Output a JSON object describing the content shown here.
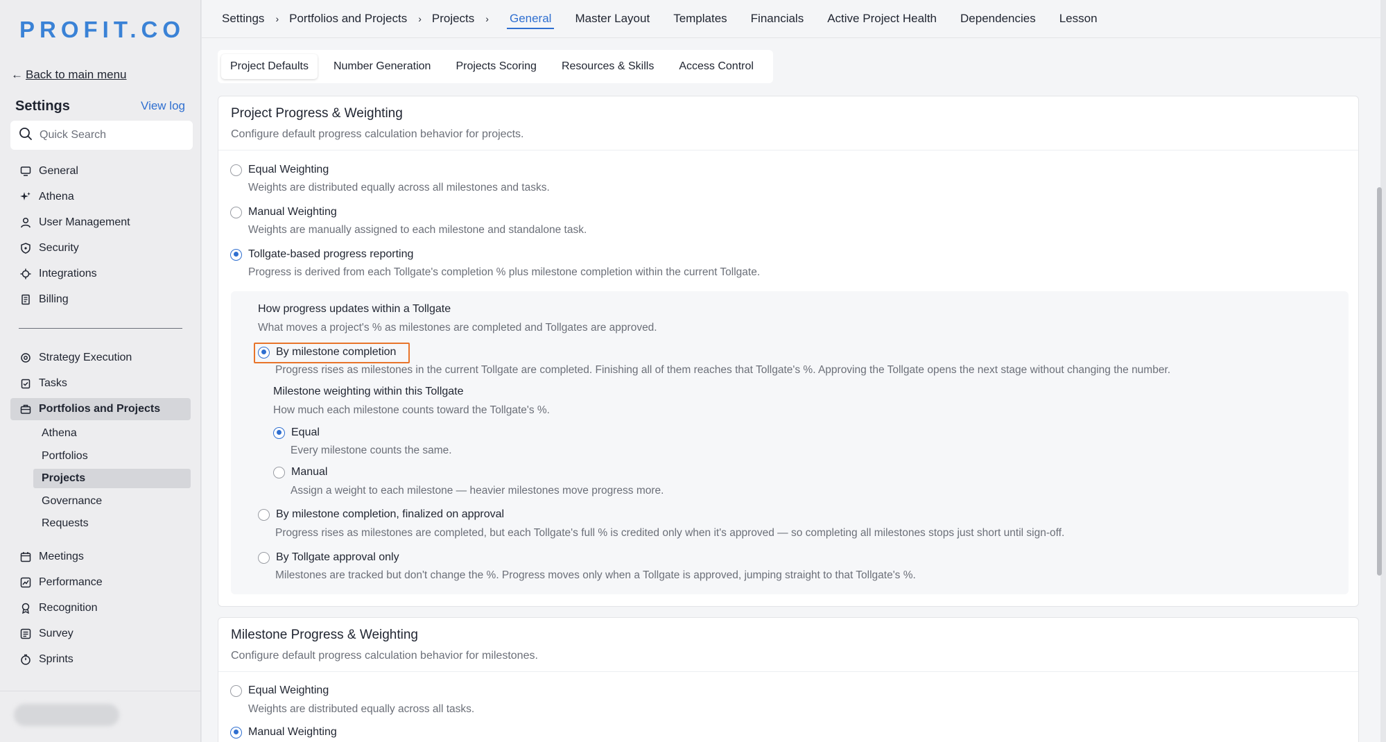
{
  "sidebar": {
    "logo": "PROFIT.CO",
    "back_link": "Back to main menu",
    "settings_title": "Settings",
    "view_log": "View log",
    "search_placeholder": "Quick Search",
    "items_top": [
      {
        "label": "General",
        "icon": "monitor-icon"
      },
      {
        "label": "Athena",
        "icon": "sparkle-icon"
      },
      {
        "label": "User Management",
        "icon": "user-icon"
      },
      {
        "label": "Security",
        "icon": "shield-icon"
      },
      {
        "label": "Integrations",
        "icon": "plug-icon"
      },
      {
        "label": "Billing",
        "icon": "receipt-icon"
      }
    ],
    "items_bottom": [
      {
        "label": "Strategy Execution",
        "icon": "target-icon"
      },
      {
        "label": "Tasks",
        "icon": "clipboard-icon"
      },
      {
        "label": "Portfolios and Projects",
        "icon": "briefcase-icon"
      },
      {
        "label": "Meetings",
        "icon": "calendar-icon"
      },
      {
        "label": "Performance",
        "icon": "chart-icon"
      },
      {
        "label": "Recognition",
        "icon": "award-icon"
      },
      {
        "label": "Survey",
        "icon": "survey-icon"
      },
      {
        "label": "Sprints",
        "icon": "stopwatch-icon"
      }
    ],
    "subitems": [
      "Athena",
      "Portfolios",
      "Projects",
      "Governance",
      "Requests"
    ],
    "active_subitem": "Projects"
  },
  "breadcrumb": [
    "Settings",
    "Portfolios and Projects",
    "Projects"
  ],
  "tabs": [
    "General",
    "Master Layout",
    "Templates",
    "Financials",
    "Active Project Health",
    "Dependencies",
    "Lesson"
  ],
  "active_tab": "General",
  "subtabs": [
    "Project Defaults",
    "Number Generation",
    "Projects Scoring",
    "Resources & Skills",
    "Access Control"
  ],
  "active_subtab": "Project Defaults",
  "project_card": {
    "title": "Project Progress & Weighting",
    "subtitle": "Configure default progress calculation behavior for projects.",
    "options": [
      {
        "label": "Equal Weighting",
        "desc": "Weights are distributed equally across all milestones and tasks.",
        "selected": false
      },
      {
        "label": "Manual Weighting",
        "desc": "Weights are manually assigned to each milestone and standalone task.",
        "selected": false
      },
      {
        "label": "Tollgate-based progress reporting",
        "desc": "Progress is derived from each Tollgate's completion % plus milestone completion within the current Tollgate.",
        "selected": true
      }
    ],
    "tollgate": {
      "heading": "How progress updates within a Tollgate",
      "subheading": "What moves a project's % as milestones are completed and Tollgates are approved.",
      "opt1_label": "By milestone completion",
      "opt1_desc": "Progress rises as milestones in the current Tollgate are completed. Finishing all of them reaches that Tollgate's %. Approving the Tollgate opens the next stage without changing the number.",
      "weighting_heading": "Milestone weighting within this Tollgate",
      "weighting_sub": "How much each milestone counts toward the Tollgate's %.",
      "equal_label": "Equal",
      "equal_desc": "Every milestone counts the same.",
      "manual_label": "Manual",
      "manual_desc": "Assign a weight to each milestone — heavier milestones move progress more.",
      "opt2_label": "By milestone completion, finalized on approval",
      "opt2_desc": "Progress rises as milestones are completed, but each Tollgate's full % is credited only when it's approved — so completing all milestones stops just short until sign-off.",
      "opt3_label": "By Tollgate approval only",
      "opt3_desc": "Milestones are tracked but don't change the %. Progress moves only when a Tollgate is approved, jumping straight to that Tollgate's %."
    }
  },
  "milestone_card": {
    "title": "Milestone Progress & Weighting",
    "subtitle": "Configure default progress calculation behavior for milestones.",
    "opt1_label": "Equal Weighting",
    "opt1_desc": "Weights are distributed equally across all tasks.",
    "opt2_label": "Manual Weighting"
  },
  "colors": {
    "accent": "#2f6fd0",
    "highlight": "#e8742a",
    "logo": "#3a82d6"
  }
}
